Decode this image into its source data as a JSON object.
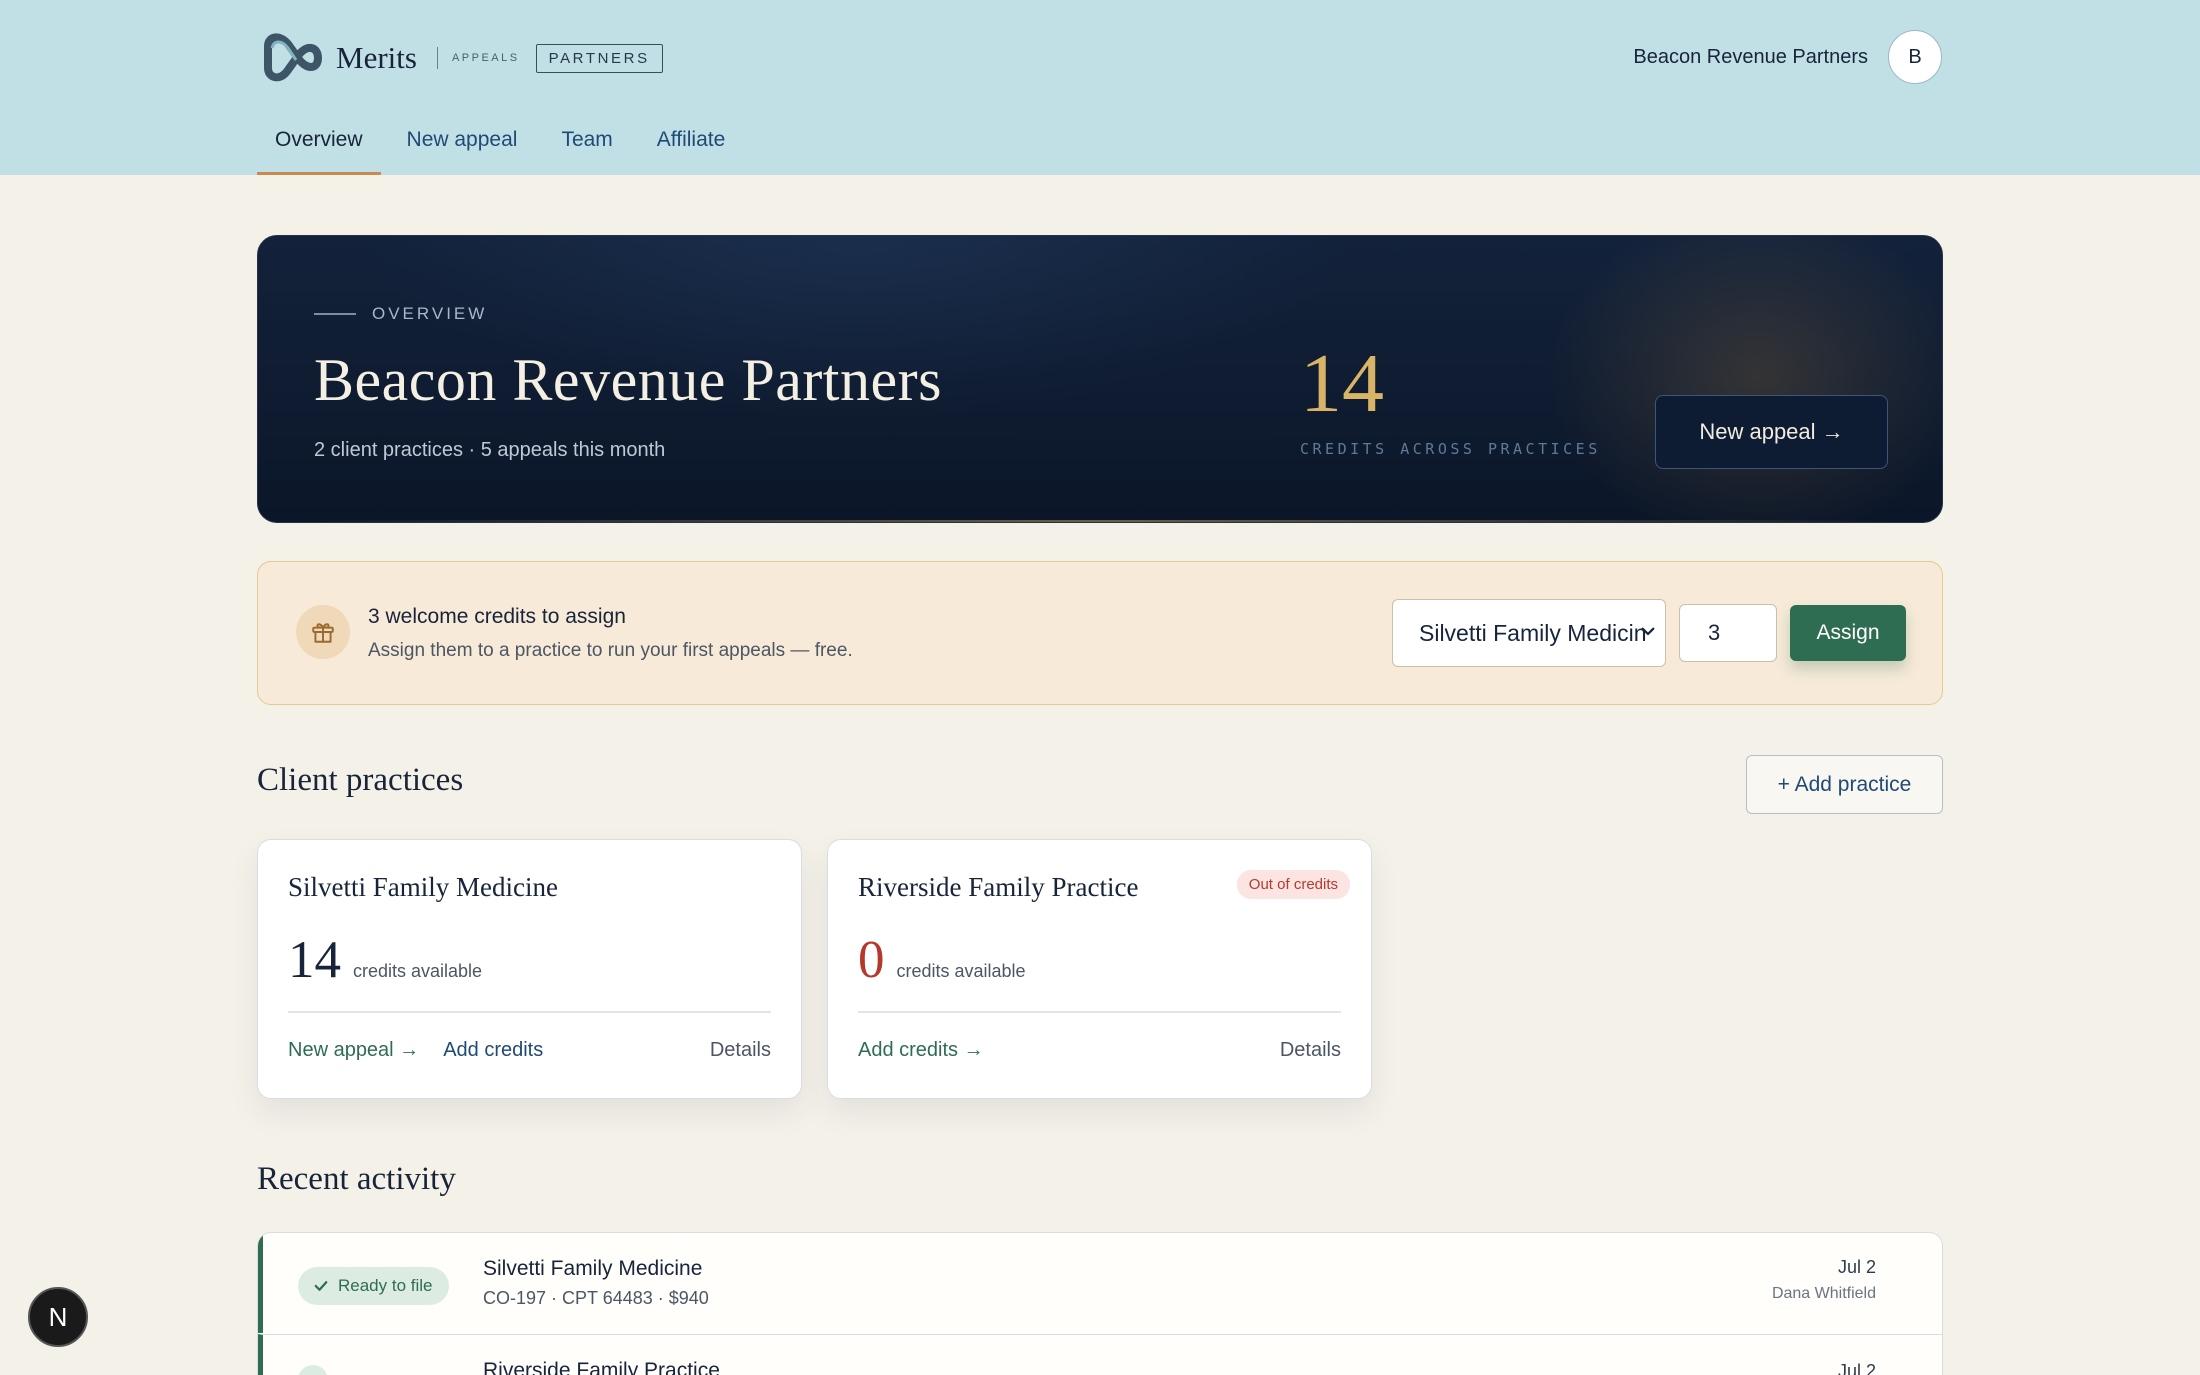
{
  "header": {
    "brand": "Merits",
    "brand_sub": "APPEALS",
    "brand_badge": "PARTNERS",
    "account_name": "Beacon Revenue Partners",
    "avatar_initial": "B"
  },
  "nav": {
    "tabs": [
      {
        "label": "Overview",
        "active": true
      },
      {
        "label": "New appeal",
        "active": false
      },
      {
        "label": "Team",
        "active": false
      },
      {
        "label": "Affiliate",
        "active": false
      }
    ]
  },
  "hero": {
    "eyebrow": "OVERVIEW",
    "title": "Beacon Revenue Partners",
    "subtitle": "2 client practices · 5 appeals this month",
    "credits": "14",
    "credits_label": "CREDITS ACROSS PRACTICES",
    "button_label": "New appeal →"
  },
  "welcome": {
    "title": "3 welcome credits to assign",
    "subtitle": "Assign them to a practice to run your first appeals — free.",
    "selected_practice": "Silvetti Family Medicine",
    "quantity": "3",
    "assign_label": "Assign",
    "icon": "gift-icon"
  },
  "practices": {
    "title": "Client practices",
    "add_label": "+ Add practice",
    "cards": [
      {
        "name": "Silvetti Family Medicine",
        "credits": "14",
        "credits_label": "credits available",
        "new_appeal_label": "New appeal →",
        "add_credits_label": "Add credits",
        "details_label": "Details"
      },
      {
        "name": "Riverside Family Practice",
        "badge": "Out of credits",
        "credits": "0",
        "credits_label": "credits available",
        "add_credits_label": "Add credits →",
        "details_label": "Details"
      }
    ]
  },
  "activity": {
    "title": "Recent activity",
    "rows": [
      {
        "status": "Ready to file",
        "practice": "Silvetti Family Medicine",
        "meta": "CO-197 · CPT 64483 · $940",
        "date": "Jul 2",
        "person": "Dana Whitfield"
      },
      {
        "practice": "Riverside Family Practice",
        "date": "Jul 2"
      }
    ]
  },
  "dev_badge": "N",
  "colors": {
    "header_bg": "#c1e0e6",
    "page_bg": "#f4f1e9",
    "hero_bg": "#0b1628",
    "accent_gold": "#d8b466",
    "accent_green": "#2f6d52",
    "nav_underline": "#c98a52",
    "danger": "#b4382c"
  }
}
